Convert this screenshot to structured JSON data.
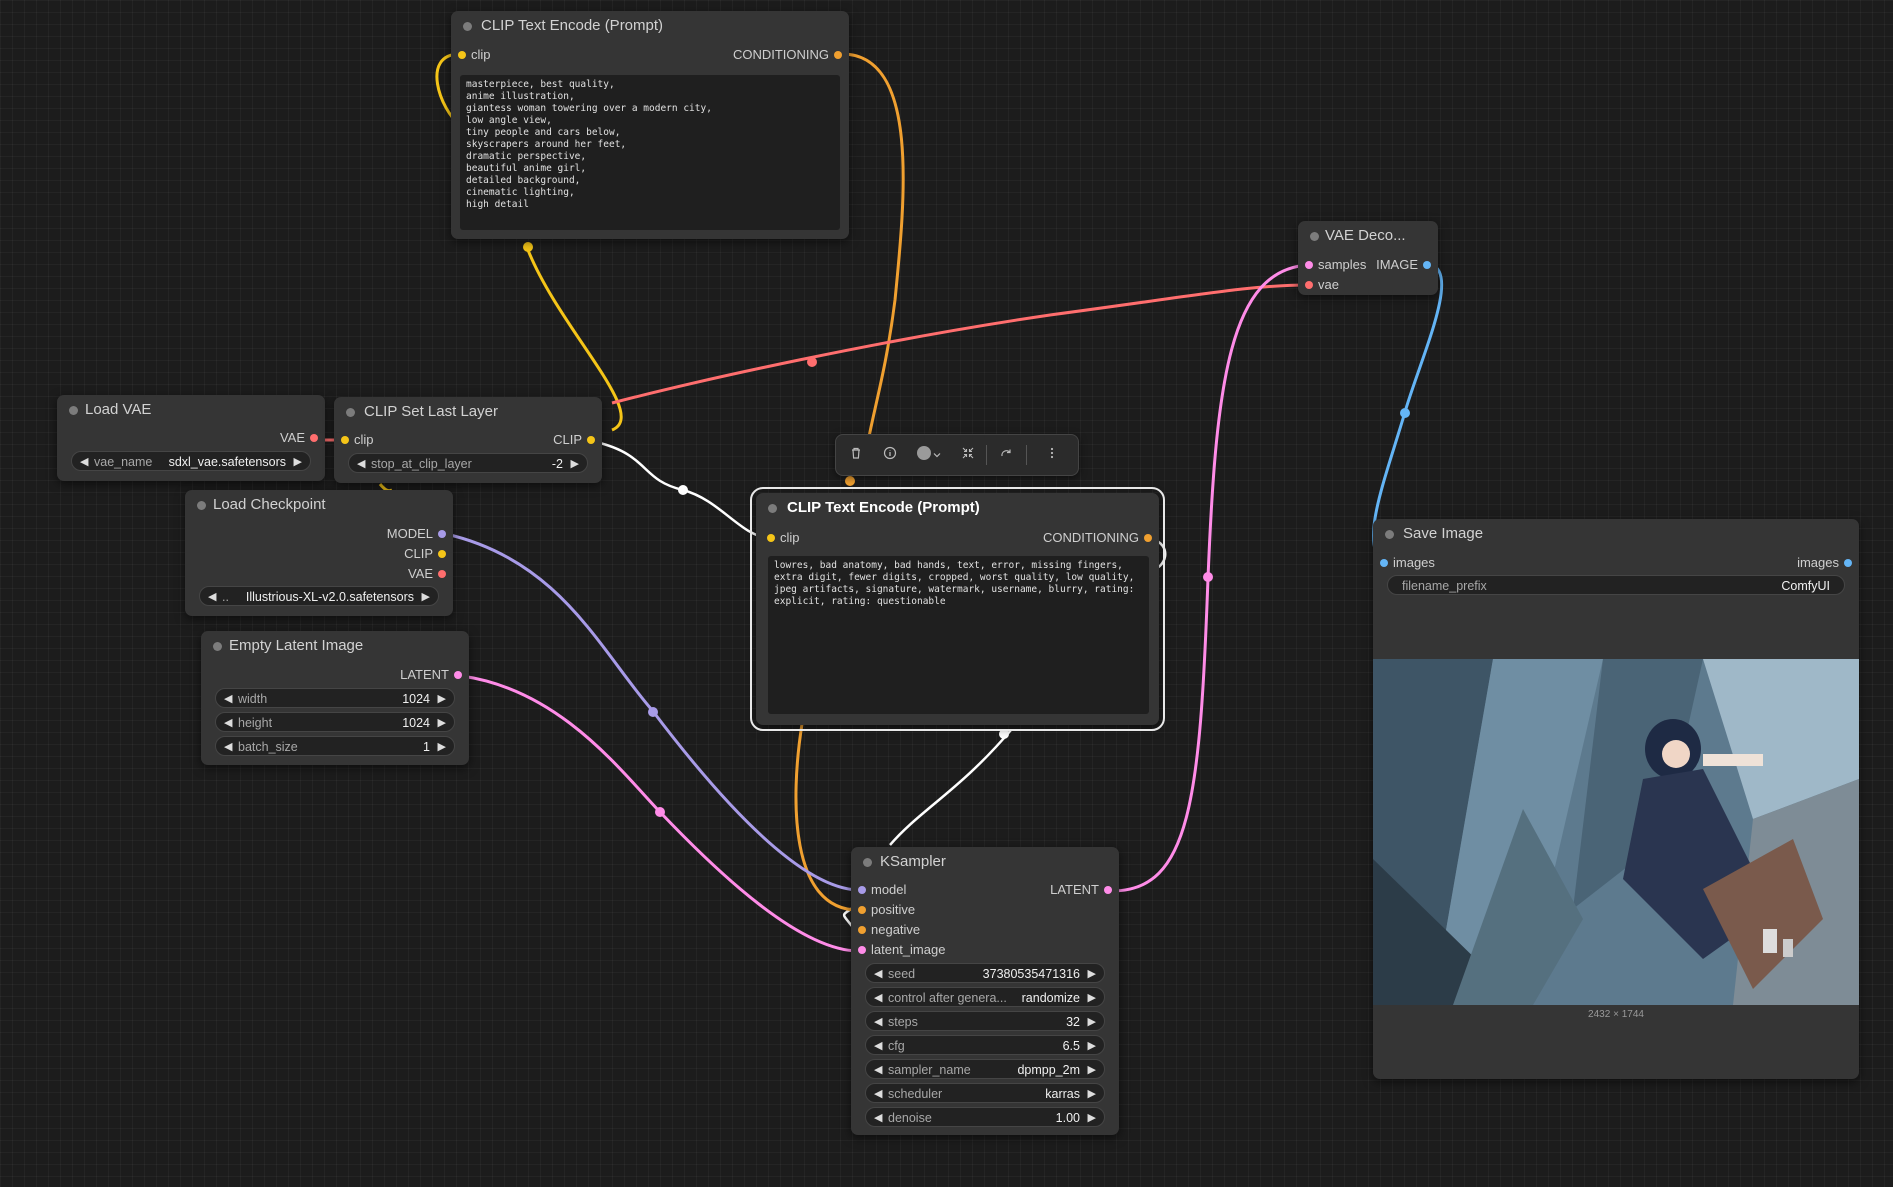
{
  "colors": {
    "clip": "#f5c518",
    "conditioning": "#f0a030",
    "vae": "#ff6e6e",
    "model": "#a89be8",
    "latent": "#ff8ce8",
    "image": "#64b5f6"
  },
  "toolbar": {
    "icons": [
      "trash-icon",
      "info-icon",
      "color-circle-icon",
      "chevron-down-icon",
      "collapse-icon",
      "redo-icon",
      "more-icon"
    ]
  },
  "clip_top": {
    "title": "CLIP Text Encode (Prompt)",
    "input": "clip",
    "output": "CONDITIONING",
    "text": "masterpiece, best quality,\nanime illustration,\ngiantess woman towering over a modern city,\nlow angle view,\ntiny people and cars below,\nskyscrapers around her feet,\ndramatic perspective,\nbeautiful anime girl,\ndetailed background,\ncinematic lighting,\nhigh detail"
  },
  "vae_decode": {
    "title": "VAE Deco...",
    "inputs": [
      "samples",
      "vae"
    ],
    "output": "IMAGE"
  },
  "load_vae": {
    "title": "Load VAE",
    "output": "VAE",
    "widget": {
      "label": "vae_name",
      "value": "sdxl_vae.safetensors"
    }
  },
  "clip_set": {
    "title": "CLIP Set Last Layer",
    "input": "clip",
    "output": "CLIP",
    "widget": {
      "label": "stop_at_clip_layer",
      "value": "-2"
    }
  },
  "load_ckpt": {
    "title": "Load Checkpoint",
    "outputs": [
      "MODEL",
      "CLIP",
      "VAE"
    ],
    "widget": {
      "label": "..",
      "value": "Illustrious-XL-v2.0.safetensors"
    }
  },
  "empty_latent": {
    "title": "Empty Latent Image",
    "output": "LATENT",
    "widgets": [
      {
        "label": "width",
        "value": "1024"
      },
      {
        "label": "height",
        "value": "1024"
      },
      {
        "label": "batch_size",
        "value": "1"
      }
    ]
  },
  "clip_neg": {
    "title": "CLIP Text Encode (Prompt)",
    "input": "clip",
    "output": "CONDITIONING",
    "text": "lowres, bad anatomy, bad hands, text, error, missing fingers, extra digit, fewer digits, cropped, worst quality, low quality, jpeg artifacts, signature, watermark, username, blurry, rating: explicit, rating: questionable"
  },
  "save_image": {
    "title": "Save Image",
    "input": "images",
    "output": "images",
    "widget": {
      "label": "filename_prefix",
      "value": "ComfyUI"
    },
    "caption": "2432 × 1744"
  },
  "ksampler": {
    "title": "KSampler",
    "inputs": [
      "model",
      "positive",
      "negative",
      "latent_image"
    ],
    "output": "LATENT",
    "widgets": [
      {
        "label": "seed",
        "value": "37380535471316"
      },
      {
        "label": "control after genera...",
        "value": "randomize"
      },
      {
        "label": "steps",
        "value": "32"
      },
      {
        "label": "cfg",
        "value": "6.5"
      },
      {
        "label": "sampler_name",
        "value": "dpmpp_2m"
      },
      {
        "label": "scheduler",
        "value": "karras"
      },
      {
        "label": "denoise",
        "value": "1.00"
      }
    ]
  }
}
